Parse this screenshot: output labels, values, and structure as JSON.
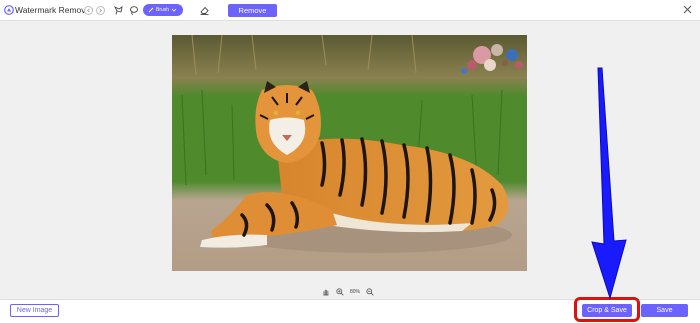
{
  "header": {
    "app_title": "Watermark Remover",
    "brush_label": "Brush",
    "remove_label": "Remove"
  },
  "zoom": {
    "level": "80%"
  },
  "footer": {
    "new_image_label": "New Image",
    "crop_save_label": "Crop & Save",
    "save_label": "Save"
  },
  "icons": {
    "logo": "app-logo-icon",
    "undo": "undo-icon",
    "redo": "redo-icon",
    "lasso": "lasso-icon",
    "polygon": "polygon-lasso-icon",
    "brush": "brush-icon",
    "eraser": "eraser-icon",
    "close": "close-icon",
    "hand": "hand-icon",
    "zoom_in": "zoom-in-icon",
    "zoom_out": "zoom-out-icon"
  },
  "colors": {
    "accent": "#6c63ff",
    "highlight": "#e01010",
    "annotation_arrow": "#1a1aff"
  }
}
